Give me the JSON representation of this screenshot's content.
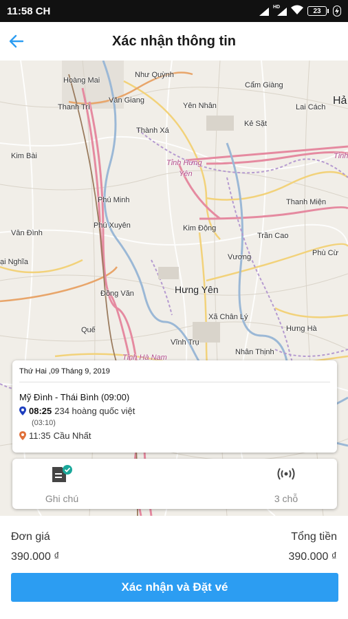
{
  "status_bar": {
    "time": "11:58 CH",
    "battery": "23",
    "signal_label": "HD"
  },
  "header": {
    "title": "Xác nhận thông tin",
    "back_icon": "arrow-left-icon"
  },
  "map": {
    "labels": {
      "hoang_mai": "Hoàng Mai",
      "nhu_quynh": "Như Quỳnh",
      "cam_giang": "Cẩm Giàng",
      "ha": "Hả",
      "thanh_tri": "Thanh Trì",
      "van_giang": "Văn Giang",
      "yen_nhan": "Yên Nhân",
      "lai_cach": "Lai Cách",
      "ke_sat": "Kẻ Sặt",
      "thanh_xa": "Thành Xá",
      "kim_bai": "Kim Bài",
      "tinh_hung_yen_1": "Tỉnh Hưng",
      "tinh_hung_yen_2": "Yên",
      "tinh_right": "Tỉnh",
      "phu_minh": "Phú Minh",
      "thanh_mien": "Thanh Miện",
      "phu_xuyen": "Phú Xuyên",
      "kim_dong": "Kim Động",
      "van_dinh": "Vân Đình",
      "tran_cao": "Trần Cao",
      "dai_nghia": "ại Nghĩa",
      "vuong": "Vương",
      "phu_cu": "Phù Cừ",
      "hung_yen": "Hưng Yên",
      "dong_van": "Đồng Văn",
      "xa_chan_ly": "Xã Chân Lý",
      "que": "Quế",
      "hung_ha": "Hưng Hà",
      "vinh_tru": "Vĩnh Trụ",
      "nhan_thinh": "Nhân Thịnh",
      "tinh_ha_nam": "Tỉnh Hà Nam"
    }
  },
  "trip": {
    "date": "Thứ Hai ,09 Tháng 9, 2019",
    "route": "Mỹ Đình - Thái Bình (09:00)",
    "pickup_time": "08:25",
    "pickup_place": "234 hoàng quốc việt",
    "duration": "(03:10)",
    "dropoff_time": "11:35",
    "dropoff_place": "Cầu Nhất",
    "pickup_pin_color": "#1e3fbf",
    "dropoff_pin_color": "#e0703a"
  },
  "options": {
    "note_label": "Ghi chú",
    "note_icon": "note-check-icon",
    "seats_label": "3 chỗ",
    "seats_icon": "broadcast-icon"
  },
  "summary": {
    "unit_price_label": "Đơn giá",
    "unit_price_value": "390.000 ₫",
    "total_label": "Tổng tiền",
    "total_value": "390.000 ₫"
  },
  "confirm_button": {
    "label": "Xác nhận và Đặt vé",
    "color": "#2c9df2"
  }
}
